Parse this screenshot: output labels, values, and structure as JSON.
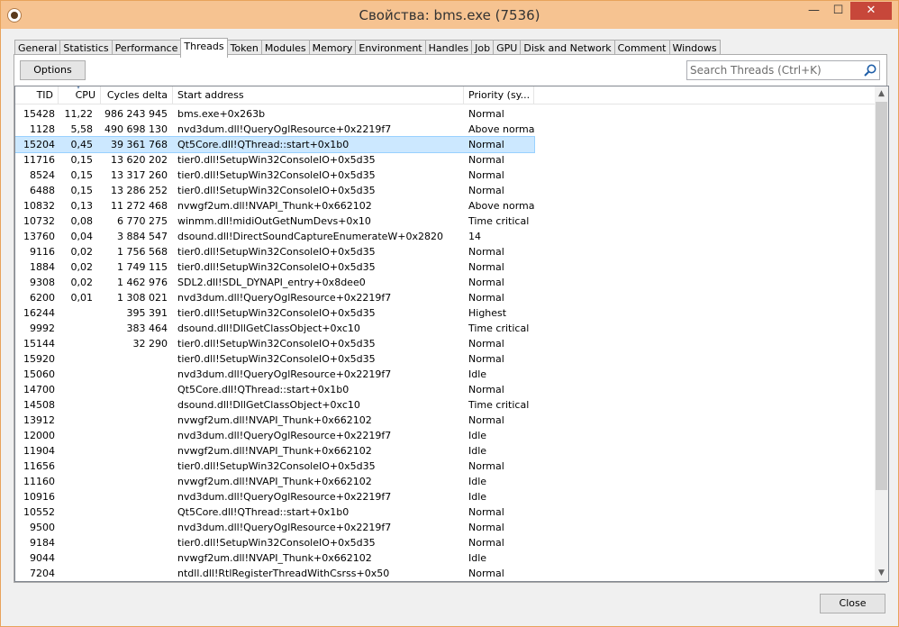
{
  "window": {
    "title": "Свойства: bms.exe (7536)",
    "min_label": "—",
    "max_label": "☐",
    "close_label": "✕"
  },
  "tabs": [
    {
      "label": "General"
    },
    {
      "label": "Statistics"
    },
    {
      "label": "Performance"
    },
    {
      "label": "Threads"
    },
    {
      "label": "Token"
    },
    {
      "label": "Modules"
    },
    {
      "label": "Memory"
    },
    {
      "label": "Environment"
    },
    {
      "label": "Handles"
    },
    {
      "label": "Job"
    },
    {
      "label": "GPU"
    },
    {
      "label": "Disk and Network"
    },
    {
      "label": "Comment"
    },
    {
      "label": "Windows"
    }
  ],
  "active_tab": "Threads",
  "toolbar": {
    "options_label": "Options",
    "search_placeholder": "Search Threads (Ctrl+K)"
  },
  "columns": {
    "tid": "TID",
    "cpu": "CPU",
    "cycles": "Cycles delta",
    "start": "Start address",
    "priority": "Priority (sy..."
  },
  "rows": [
    {
      "tid": "15428",
      "cpu": "11,22",
      "cycles": "986 243 945",
      "start": "bms.exe+0x263b",
      "priority": "Normal"
    },
    {
      "tid": "1128",
      "cpu": "5,58",
      "cycles": "490 698 130",
      "start": "nvd3dum.dll!QueryOglResource+0x2219f7",
      "priority": "Above normal"
    },
    {
      "tid": "15204",
      "cpu": "0,45",
      "cycles": "39 361 768",
      "start": "Qt5Core.dll!QThread::start+0x1b0",
      "priority": "Normal"
    },
    {
      "tid": "11716",
      "cpu": "0,15",
      "cycles": "13 620 202",
      "start": "tier0.dll!SetupWin32ConsoleIO+0x5d35",
      "priority": "Normal"
    },
    {
      "tid": "8524",
      "cpu": "0,15",
      "cycles": "13 317 260",
      "start": "tier0.dll!SetupWin32ConsoleIO+0x5d35",
      "priority": "Normal"
    },
    {
      "tid": "6488",
      "cpu": "0,15",
      "cycles": "13 286 252",
      "start": "tier0.dll!SetupWin32ConsoleIO+0x5d35",
      "priority": "Normal"
    },
    {
      "tid": "10832",
      "cpu": "0,13",
      "cycles": "11 272 468",
      "start": "nvwgf2um.dll!NVAPI_Thunk+0x662102",
      "priority": "Above normal"
    },
    {
      "tid": "10732",
      "cpu": "0,08",
      "cycles": "6 770 275",
      "start": "winmm.dll!midiOutGetNumDevs+0x10",
      "priority": "Time critical"
    },
    {
      "tid": "13760",
      "cpu": "0,04",
      "cycles": "3 884 547",
      "start": "dsound.dll!DirectSoundCaptureEnumerateW+0x2820",
      "priority": "14"
    },
    {
      "tid": "9116",
      "cpu": "0,02",
      "cycles": "1 756 568",
      "start": "tier0.dll!SetupWin32ConsoleIO+0x5d35",
      "priority": "Normal"
    },
    {
      "tid": "1884",
      "cpu": "0,02",
      "cycles": "1 749 115",
      "start": "tier0.dll!SetupWin32ConsoleIO+0x5d35",
      "priority": "Normal"
    },
    {
      "tid": "9308",
      "cpu": "0,02",
      "cycles": "1 462 976",
      "start": "SDL2.dll!SDL_DYNAPI_entry+0x8dee0",
      "priority": "Normal"
    },
    {
      "tid": "6200",
      "cpu": "0,01",
      "cycles": "1 308 021",
      "start": "nvd3dum.dll!QueryOglResource+0x2219f7",
      "priority": "Normal"
    },
    {
      "tid": "16244",
      "cpu": "",
      "cycles": "395 391",
      "start": "tier0.dll!SetupWin32ConsoleIO+0x5d35",
      "priority": "Highest"
    },
    {
      "tid": "9992",
      "cpu": "",
      "cycles": "383 464",
      "start": "dsound.dll!DllGetClassObject+0xc10",
      "priority": "Time critical"
    },
    {
      "tid": "15144",
      "cpu": "",
      "cycles": "32 290",
      "start": "tier0.dll!SetupWin32ConsoleIO+0x5d35",
      "priority": "Normal"
    },
    {
      "tid": "15920",
      "cpu": "",
      "cycles": "",
      "start": "tier0.dll!SetupWin32ConsoleIO+0x5d35",
      "priority": "Normal"
    },
    {
      "tid": "15060",
      "cpu": "",
      "cycles": "",
      "start": "nvd3dum.dll!QueryOglResource+0x2219f7",
      "priority": "Idle"
    },
    {
      "tid": "14700",
      "cpu": "",
      "cycles": "",
      "start": "Qt5Core.dll!QThread::start+0x1b0",
      "priority": "Normal"
    },
    {
      "tid": "14508",
      "cpu": "",
      "cycles": "",
      "start": "dsound.dll!DllGetClassObject+0xc10",
      "priority": "Time critical"
    },
    {
      "tid": "13912",
      "cpu": "",
      "cycles": "",
      "start": "nvwgf2um.dll!NVAPI_Thunk+0x662102",
      "priority": "Normal"
    },
    {
      "tid": "12000",
      "cpu": "",
      "cycles": "",
      "start": "nvd3dum.dll!QueryOglResource+0x2219f7",
      "priority": "Idle"
    },
    {
      "tid": "11904",
      "cpu": "",
      "cycles": "",
      "start": "nvwgf2um.dll!NVAPI_Thunk+0x662102",
      "priority": "Idle"
    },
    {
      "tid": "11656",
      "cpu": "",
      "cycles": "",
      "start": "tier0.dll!SetupWin32ConsoleIO+0x5d35",
      "priority": "Normal"
    },
    {
      "tid": "11160",
      "cpu": "",
      "cycles": "",
      "start": "nvwgf2um.dll!NVAPI_Thunk+0x662102",
      "priority": "Idle"
    },
    {
      "tid": "10916",
      "cpu": "",
      "cycles": "",
      "start": "nvd3dum.dll!QueryOglResource+0x2219f7",
      "priority": "Idle"
    },
    {
      "tid": "10552",
      "cpu": "",
      "cycles": "",
      "start": "Qt5Core.dll!QThread::start+0x1b0",
      "priority": "Normal"
    },
    {
      "tid": "9500",
      "cpu": "",
      "cycles": "",
      "start": "nvd3dum.dll!QueryOglResource+0x2219f7",
      "priority": "Normal"
    },
    {
      "tid": "9184",
      "cpu": "",
      "cycles": "",
      "start": "tier0.dll!SetupWin32ConsoleIO+0x5d35",
      "priority": "Normal"
    },
    {
      "tid": "9044",
      "cpu": "",
      "cycles": "",
      "start": "nvwgf2um.dll!NVAPI_Thunk+0x662102",
      "priority": "Idle"
    },
    {
      "tid": "7204",
      "cpu": "",
      "cycles": "",
      "start": "ntdll.dll!RtlRegisterThreadWithCsrss+0x50",
      "priority": "Normal"
    }
  ],
  "selected_row_tid": "15204",
  "footer": {
    "close_label": "Close"
  },
  "colors": {
    "titlebar": "#f6c391",
    "selection": "#cce8ff",
    "close_button": "#c7473a"
  }
}
